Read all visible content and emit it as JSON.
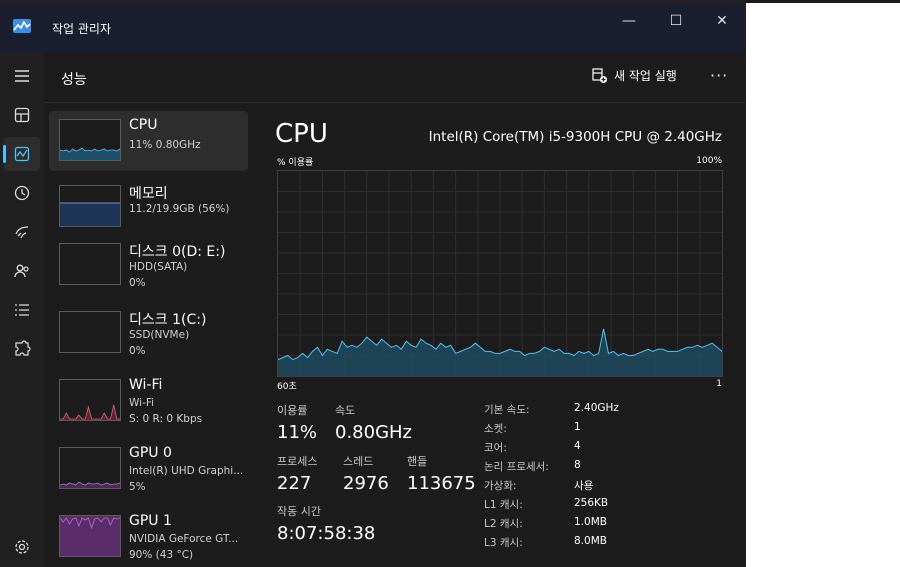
{
  "window": {
    "title": "작업 관리자"
  },
  "titlebar_controls": {
    "minimize": "—",
    "maximize": "☐",
    "close": "✕"
  },
  "nav": [
    {
      "name": "menu-icon"
    },
    {
      "name": "processes-icon"
    },
    {
      "name": "performance-icon",
      "active": true
    },
    {
      "name": "app-history-icon"
    },
    {
      "name": "startup-apps-icon"
    },
    {
      "name": "users-icon"
    },
    {
      "name": "details-icon"
    },
    {
      "name": "services-icon"
    },
    {
      "name": "settings-icon"
    }
  ],
  "header": {
    "title": "성능",
    "new_task": "새 작업 실행",
    "more": "···"
  },
  "sidebar": [
    {
      "name": "CPU",
      "line1": "11% 0.80GHz",
      "line2": "",
      "color": "#4cc2ff",
      "selected": true
    },
    {
      "name": "메모리",
      "line1": "11.2/19.9GB (56%)",
      "line2": "",
      "color": "#6f8fdc"
    },
    {
      "name": "디스크 0(D: E:)",
      "line1": "HDD(SATA)",
      "line2": "0%",
      "color": "#8bc34a"
    },
    {
      "name": "디스크 1(C:)",
      "line1": "SSD(NVMe)",
      "line2": "0%",
      "color": "#8bc34a"
    },
    {
      "name": "Wi-Fi",
      "line1": "Wi-Fi",
      "line2": "S: 0 R: 0 Kbps",
      "color": "#e0607e"
    },
    {
      "name": "GPU 0",
      "line1": "Intel(R) UHD Graphi...",
      "line2": "5%",
      "color": "#b86fd1"
    },
    {
      "name": "GPU 1",
      "line1": "NVIDIA GeForce GT...",
      "line2": "90% (43 °C)",
      "color": "#b86fd1"
    }
  ],
  "main": {
    "title": "CPU",
    "model": "Intel(R) Core(TM) i5-9300H CPU @ 2.40GHz",
    "graph": {
      "ylabel": "% 이용률",
      "ymax_label": "100%",
      "xlabel_left": "60초",
      "xlabel_right": "1",
      "line_color": "#4cc2ff"
    },
    "stats": {
      "util_label": "이용률",
      "util_value": "11%",
      "speed_label": "속도",
      "speed_value": "0.80GHz",
      "proc_label": "프로세스",
      "proc_value": "227",
      "thread_label": "스레드",
      "thread_value": "2976",
      "handle_label": "핸들",
      "handle_value": "113675",
      "uptime_label": "작동 시간",
      "uptime_value": "8:07:58:38"
    },
    "specs": [
      {
        "label": "기본 속도:",
        "value": "2.40GHz"
      },
      {
        "label": "소켓:",
        "value": "1"
      },
      {
        "label": "코어:",
        "value": "4"
      },
      {
        "label": "논리 프로세서:",
        "value": "8"
      },
      {
        "label": "가상화:",
        "value": "사용"
      },
      {
        "label": "L1 캐시:",
        "value": "256KB"
      },
      {
        "label": "L2 캐시:",
        "value": "1.0MB"
      },
      {
        "label": "L3 캐시:",
        "value": "8.0MB"
      }
    ]
  }
}
